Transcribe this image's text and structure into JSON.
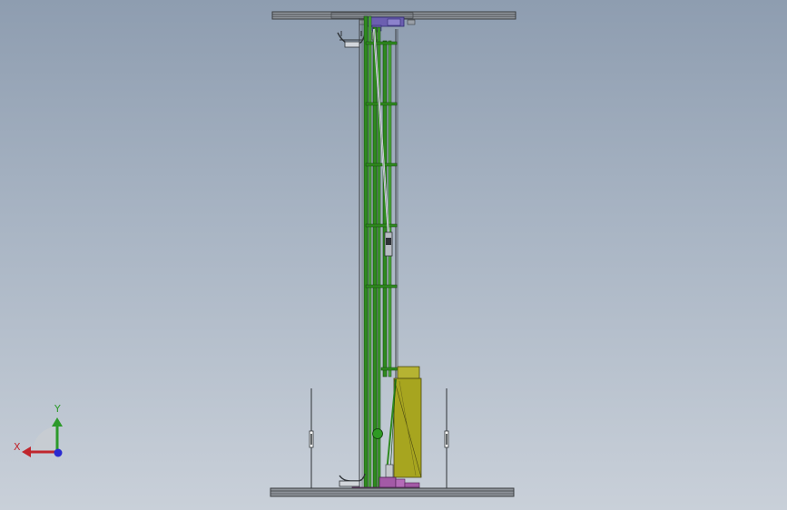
{
  "viewport": {
    "background_top": "#8e9db0",
    "background_bottom": "#c9d0d9"
  },
  "model": {
    "frame_color": "#6b7076",
    "rail_color": "#2f8a1f",
    "motor_color": "#a7a51f",
    "base_fitting_color": "#a35aa6",
    "top_fitting_color": "#6c5fb0"
  },
  "triad": {
    "x_label": "X",
    "y_label": "Y",
    "x_color": "#c0262d",
    "y_color": "#2d9a2a",
    "z_color": "#2a2ad0"
  }
}
